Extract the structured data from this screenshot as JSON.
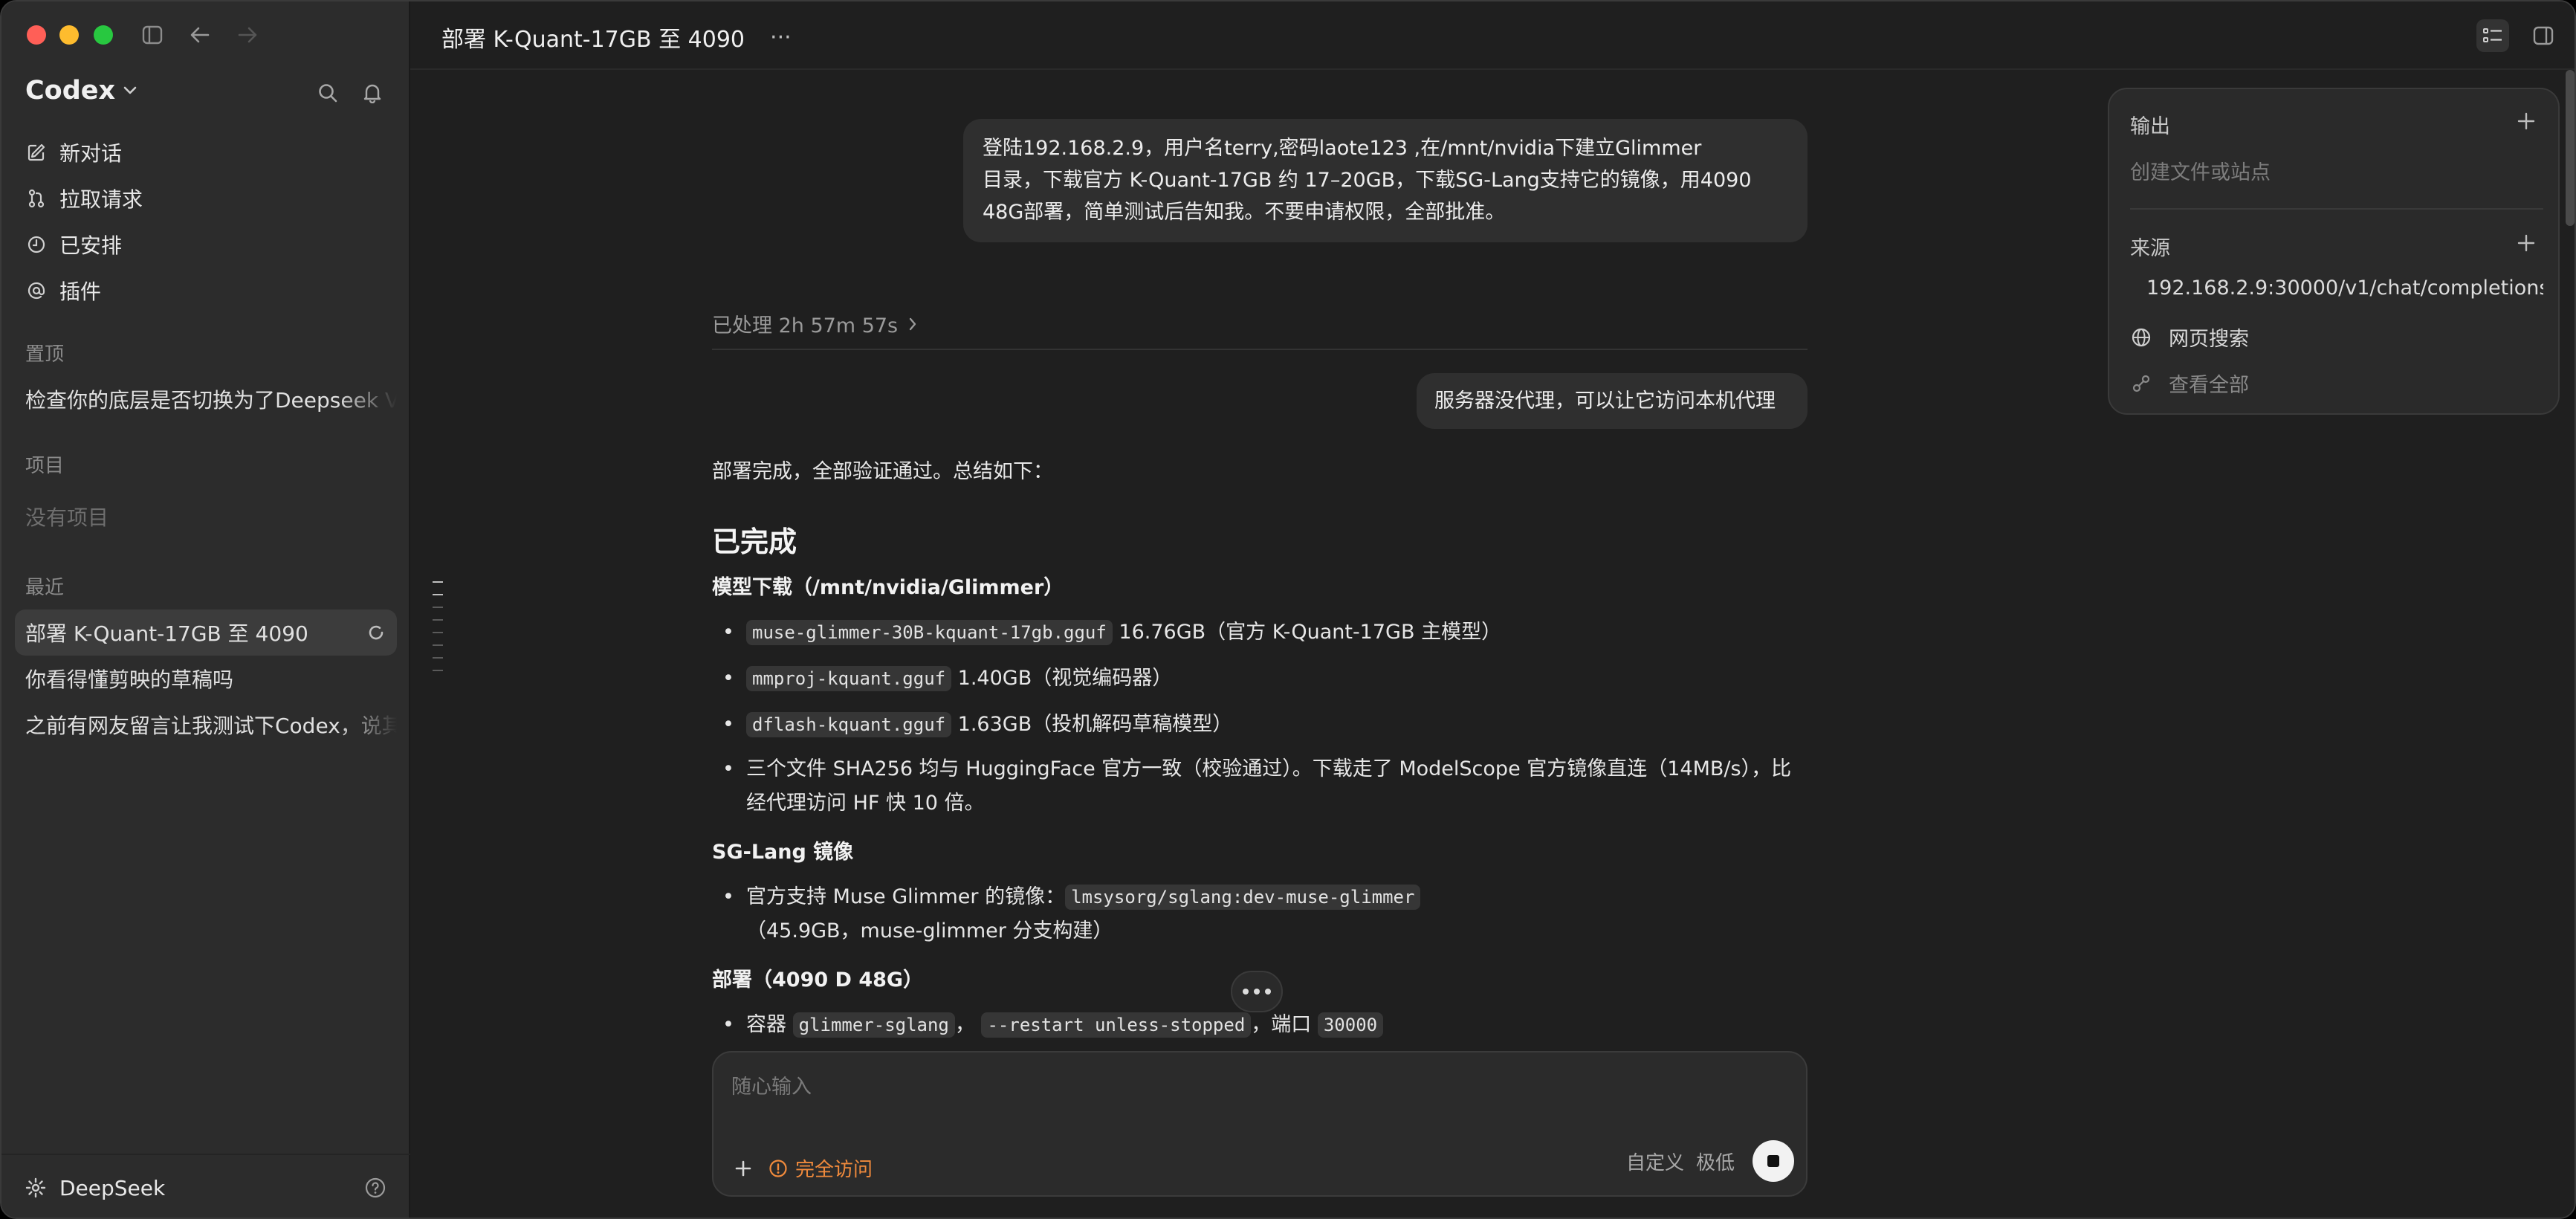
{
  "window": {
    "controls": [
      "close",
      "minimize",
      "zoom"
    ]
  },
  "sidebar": {
    "brand": "Codex",
    "nav": [
      {
        "label": "新对话",
        "icon": "edit-icon"
      },
      {
        "label": "拉取请求",
        "icon": "pull-request-icon"
      },
      {
        "label": "已安排",
        "icon": "clock-icon"
      },
      {
        "label": "插件",
        "icon": "at-icon"
      }
    ],
    "pinned_label": "置顶",
    "pinned_items": [
      "检查你的底层是否切换为了Deepseek V"
    ],
    "projects_label": "项目",
    "no_projects": "没有项目",
    "recent_label": "最近",
    "recent_items": [
      {
        "label": "部署 K-Quant-17GB 至 4090",
        "active": true
      },
      {
        "label": "你看得懂剪映的草稿吗",
        "active": false
      },
      {
        "label": "之前有网友留言让我测试下Codex，说其",
        "active": false
      }
    ],
    "footer_label": "DeepSeek"
  },
  "topbar": {
    "title": "部署 K-Quant-17GB 至 4090",
    "more": "···"
  },
  "chat": {
    "user_message_1": [
      "登陆192.168.2.9，用户名terry,密码laote123 ,在/mnt/nvidia下建立Glimmer",
      "目录，下载官方 K-Quant-17GB 约 17–20GB，下载SG-Lang支持它的镜像，用4090",
      "48G部署，简单测试后告知我。不要申请权限，全部批准。"
    ],
    "processed_label": "已处理 2h 57m 57s",
    "user_message_2": "服务器没代理，可以让它访问本机代理",
    "reply_intro": "部署完成，全部验证通过。总结如下：",
    "heading_done": "已完成",
    "section_download": "模型下载（/mnt/nvidia/Glimmer）",
    "downloads": [
      {
        "code": "muse-glimmer-30B-kquant-17gb.gguf",
        "text": " 16.76GB（官方 K-Quant-17GB 主模型）"
      },
      {
        "code": "mmproj-kquant.gguf",
        "text": " 1.40GB（视觉编码器）"
      },
      {
        "code": "dflash-kquant.gguf",
        "text": " 1.63GB（投机解码草稿模型）"
      }
    ],
    "sha_line_1": "三个文件 SHA256 均与 HuggingFace 官方一致（校验通过）。下载走了 ModelScope 官方镜像直连（14MB/s），比",
    "sha_line_2": "经代理访问 HF 快 10 倍。",
    "section_image": "SG-Lang 镜像",
    "image_prefix": "官方支持 Muse Glimmer 的镜像：",
    "image_code": "lmsysorg/sglang:dev-muse-glimmer",
    "image_note": "（45.9GB，muse-glimmer 分支构建）",
    "section_deploy": "部署（4090 D 48G）",
    "deploy_prefix": "容器",
    "deploy_container": "glimmer-sglang",
    "deploy_sep": "，",
    "deploy_restart": "--restart unless-stopped",
    "deploy_port_label": "，端口",
    "deploy_port": "30000"
  },
  "composer": {
    "placeholder": "随心输入",
    "access_label": "完全访问",
    "custom_label": "自定义",
    "level_label": "极低"
  },
  "panel": {
    "output_title": "输出",
    "output_hint": "创建文件或站点",
    "sources_title": "来源",
    "sources": [
      {
        "icon": "link-icon",
        "label": "192.168.2.9:30000/v1/chat/completions"
      },
      {
        "icon": "globe-icon",
        "label": "网页搜索"
      },
      {
        "icon": "sources-icon",
        "label": "查看全部"
      }
    ]
  },
  "colors": {
    "accent_orange": "#f08a3c",
    "background": "#1f1f1f",
    "sidebar": "#2c2c2c"
  }
}
